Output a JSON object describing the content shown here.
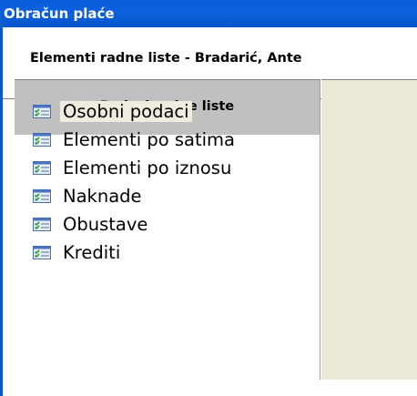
{
  "window": {
    "title": "Obračun plaće"
  },
  "header": {
    "title": "Elementi radne liste - Bradarić, Ante"
  },
  "panel": {
    "title": "Podaci radne liste",
    "items": [
      {
        "label": "Osobni podaci",
        "icon": "list-check-icon",
        "selected": true
      },
      {
        "label": "Elementi po satima",
        "icon": "list-check-icon",
        "selected": false
      },
      {
        "label": "Elementi po iznosu",
        "icon": "list-check-icon",
        "selected": false
      },
      {
        "label": "Naknade",
        "icon": "list-check-icon",
        "selected": false
      },
      {
        "label": "Obustave",
        "icon": "list-check-icon",
        "selected": false
      },
      {
        "label": "Krediti",
        "icon": "list-check-icon",
        "selected": false
      }
    ]
  },
  "colors": {
    "titlebar": "#0a5fd8",
    "panel_header": "#c0c0c0",
    "content_area": "#ece9d8",
    "selected_item": "#f1ece0"
  }
}
